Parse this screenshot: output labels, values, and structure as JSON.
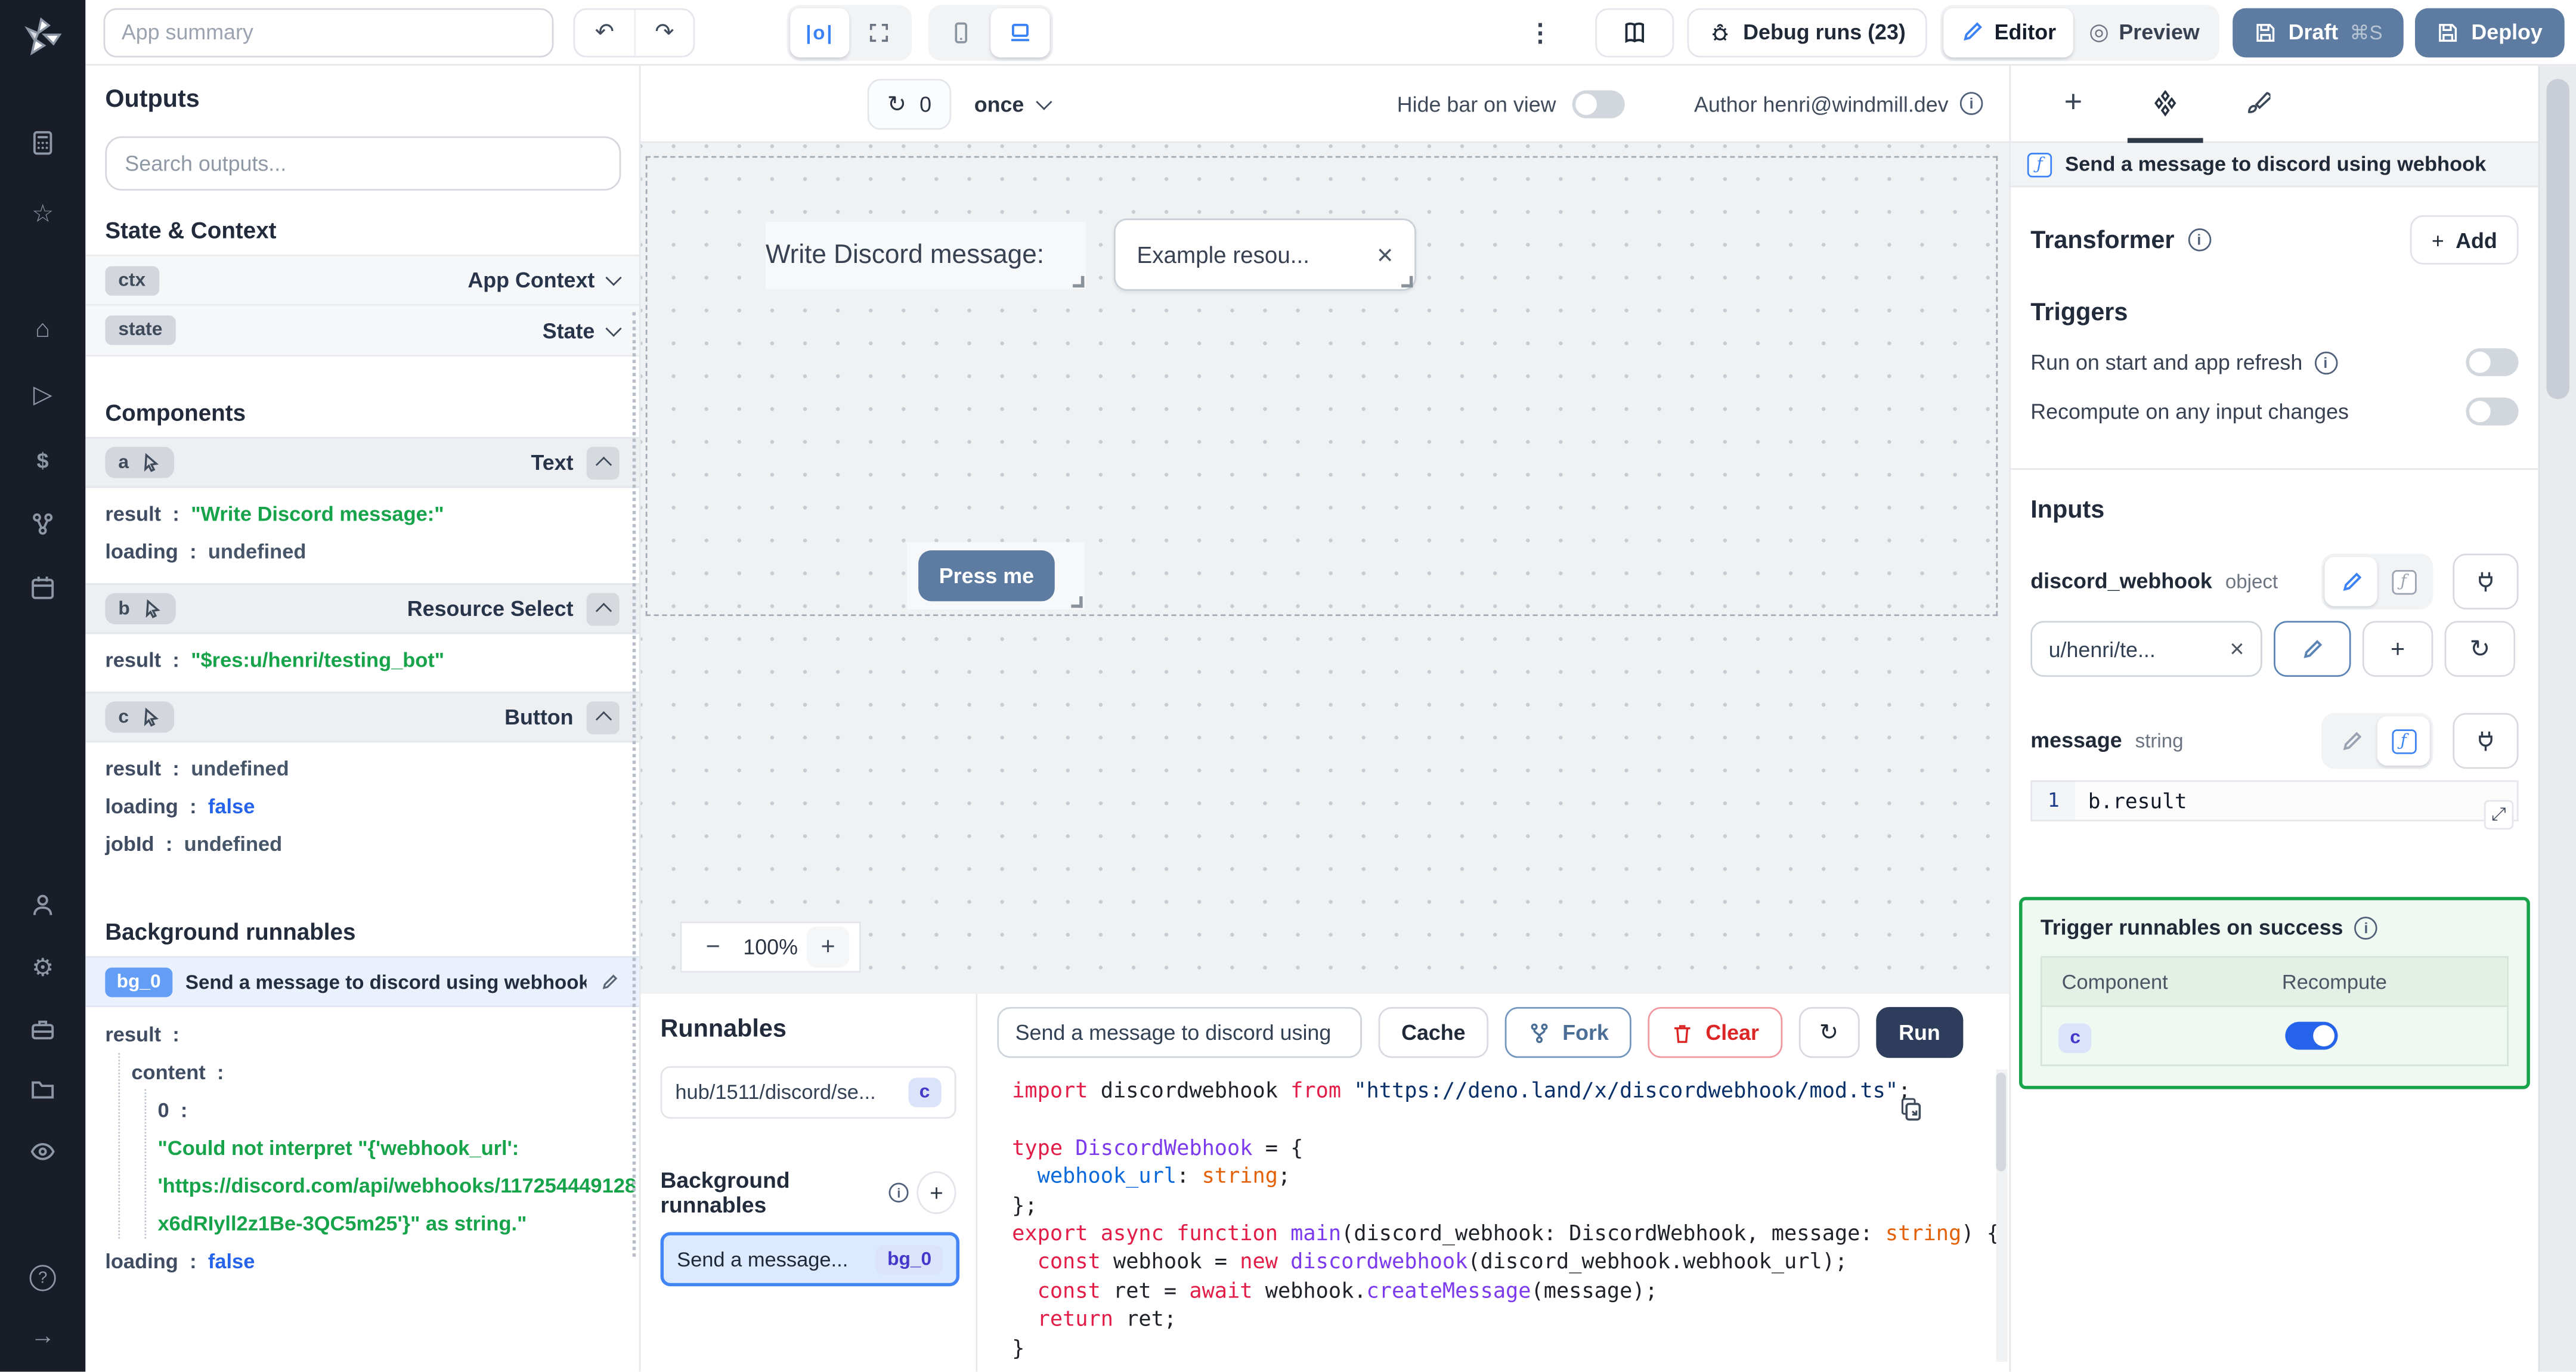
{
  "topbar": {
    "app_summary_placeholder": "App summary",
    "kebab": "⋮",
    "debug_runs": "Debug runs (23)",
    "editor": "Editor",
    "preview": "Preview",
    "draft": "Draft",
    "draft_shortcut": "⌘S",
    "deploy": "Deploy"
  },
  "canvas_toolbar": {
    "refresh_count": "0",
    "mode": "once",
    "hide_bar": "Hide bar on view",
    "author": "Author henri@windmill.dev"
  },
  "canvas": {
    "text_component": "Write Discord message:",
    "select_value": "Example resou...",
    "clear_x": "×",
    "button_label": "Press me",
    "zoom": "100%",
    "zoom_out": "−",
    "zoom_in": "+"
  },
  "outputs": {
    "title": "Outputs",
    "search_placeholder": "Search outputs...",
    "state_context": "State & Context",
    "ctx_id": "ctx",
    "ctx_type": "App Context",
    "state_id": "state",
    "state_type": "State",
    "components": "Components",
    "colon": ":",
    "key_result": "result",
    "key_loading": "loading",
    "key_jobid": "jobId",
    "key_content": "content",
    "a_id": "a",
    "a_type": "Text",
    "a_result": "\"Write Discord message:\"",
    "a_loading": "undefined",
    "b_id": "b",
    "b_type": "Resource Select",
    "b_result": "\"$res:u/henri/testing_bot\"",
    "c_id": "c",
    "c_type": "Button",
    "c_result": "undefined",
    "c_loading": "false",
    "c_jobid": "undefined",
    "bg_title": "Background runnables",
    "bg0_id": "bg_0",
    "bg0_name": "Send a message to discord using webhook",
    "bg0_index": "0",
    "bg0_err1": "\"Could not interpret \"{'webhook_url':",
    "bg0_err2": "'https://discord.com/api/webhooks/117254449128",
    "bg0_err3": "x6dRIyll2z1Be-3QC5m25'}\" as string.\"",
    "bg0_loading": "false"
  },
  "runnables": {
    "title": "Runnables",
    "item_path": "hub/1511/discord/se...",
    "item_badge": "c",
    "bg_title": "Background runnables",
    "bg_item": "Send a message...",
    "bg_badge": "bg_0"
  },
  "editor": {
    "name_value": "Send a message to discord using",
    "cache": "Cache",
    "fork": "Fork",
    "clear": "Clear",
    "run": "Run",
    "code_lines": [
      [
        {
          "t": "import ",
          "c": "k"
        },
        {
          "t": "discordwebhook ",
          "c": "p"
        },
        {
          "t": "from ",
          "c": "k"
        },
        {
          "t": "\"https://deno.land/x/discordwebhook/mod.ts\"",
          "c": "s"
        },
        {
          "t": ";",
          "c": "p"
        }
      ],
      [],
      [
        {
          "t": "type ",
          "c": "k"
        },
        {
          "t": "DiscordWebhook",
          "c": "fn"
        },
        {
          "t": " = {",
          "c": "p"
        }
      ],
      [
        {
          "t": "  webhook_url",
          "c": "prop"
        },
        {
          "t": ": ",
          "c": "p"
        },
        {
          "t": "string",
          "c": "ty"
        },
        {
          "t": ";",
          "c": "p"
        }
      ],
      [
        {
          "t": "};",
          "c": "p"
        }
      ],
      [
        {
          "t": "export ",
          "c": "k"
        },
        {
          "t": "async ",
          "c": "k"
        },
        {
          "t": "function ",
          "c": "k"
        },
        {
          "t": "main",
          "c": "fn"
        },
        {
          "t": "(discord_webhook: DiscordWebhook, message: ",
          "c": "p"
        },
        {
          "t": "string",
          "c": "ty"
        },
        {
          "t": ") {",
          "c": "p"
        }
      ],
      [
        {
          "t": "  const ",
          "c": "k"
        },
        {
          "t": "webhook = ",
          "c": "p"
        },
        {
          "t": "new ",
          "c": "k"
        },
        {
          "t": "discordwebhook",
          "c": "fn"
        },
        {
          "t": "(discord_webhook.webhook_url);",
          "c": "p"
        }
      ],
      [
        {
          "t": "  const ",
          "c": "k"
        },
        {
          "t": "ret = ",
          "c": "p"
        },
        {
          "t": "await ",
          "c": "k"
        },
        {
          "t": "webhook.",
          "c": "p"
        },
        {
          "t": "createMessage",
          "c": "fn"
        },
        {
          "t": "(message);",
          "c": "p"
        }
      ],
      [
        {
          "t": "  return ",
          "c": "k"
        },
        {
          "t": "ret;",
          "c": "p"
        }
      ],
      [
        {
          "t": "}",
          "c": "p"
        }
      ]
    ]
  },
  "right": {
    "header": "Send a message to discord using webhook",
    "transformer": "Transformer",
    "add": "Add",
    "add_plus": "+",
    "triggers": "Triggers",
    "trigger_start": "Run on start and app refresh",
    "trigger_recompute": "Recompute on any input changes",
    "inputs": "Inputs",
    "in1_name": "discord_webhook",
    "in1_type": "object",
    "in1_value": "u/henri/te...",
    "in1_clear": "×",
    "plus": "+",
    "refresh": "↻",
    "in2_name": "message",
    "in2_type": "string",
    "in2_line": "1",
    "in2_code": "b.result",
    "expand_glyph": "⤢",
    "success_title": "Trigger runnables on success",
    "col_component": "Component",
    "col_recompute": "Recompute",
    "row_c": "c"
  },
  "colors": {
    "accent_blue": "#3b82f6",
    "slate_button": "#5e7ca1",
    "run_button": "#2e3d5b",
    "success_green": "#16a34a",
    "value_green": "#16a34a",
    "value_blue": "#2563eb",
    "indigo_badge": "#4338ca",
    "toggle_on": "#2563eb",
    "rail_bg": "#191d27"
  }
}
